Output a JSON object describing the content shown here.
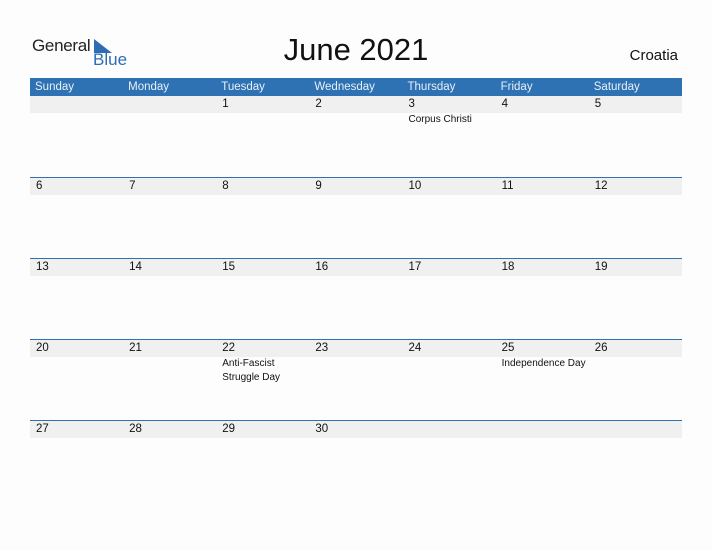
{
  "brand": {
    "word1": "General",
    "word2": "Blue"
  },
  "title": "June 2021",
  "country": "Croatia",
  "weekdays": [
    "Sunday",
    "Monday",
    "Tuesday",
    "Wednesday",
    "Thursday",
    "Friday",
    "Saturday"
  ],
  "weeks": [
    [
      {
        "d": ""
      },
      {
        "d": ""
      },
      {
        "d": "1"
      },
      {
        "d": "2"
      },
      {
        "d": "3",
        "h": "Corpus Christi"
      },
      {
        "d": "4"
      },
      {
        "d": "5"
      }
    ],
    [
      {
        "d": "6"
      },
      {
        "d": "7"
      },
      {
        "d": "8"
      },
      {
        "d": "9"
      },
      {
        "d": "10"
      },
      {
        "d": "11"
      },
      {
        "d": "12"
      }
    ],
    [
      {
        "d": "13"
      },
      {
        "d": "14"
      },
      {
        "d": "15"
      },
      {
        "d": "16"
      },
      {
        "d": "17"
      },
      {
        "d": "18"
      },
      {
        "d": "19"
      }
    ],
    [
      {
        "d": "20"
      },
      {
        "d": "21"
      },
      {
        "d": "22",
        "h": "Anti-Fascist Struggle Day"
      },
      {
        "d": "23"
      },
      {
        "d": "24"
      },
      {
        "d": "25",
        "h": "Independence Day"
      },
      {
        "d": "26"
      }
    ],
    [
      {
        "d": "27"
      },
      {
        "d": "28"
      },
      {
        "d": "29"
      },
      {
        "d": "30"
      },
      {
        "d": ""
      },
      {
        "d": ""
      },
      {
        "d": ""
      }
    ]
  ],
  "colors": {
    "accent": "#2e72b3",
    "band": "#f0f0f0"
  }
}
